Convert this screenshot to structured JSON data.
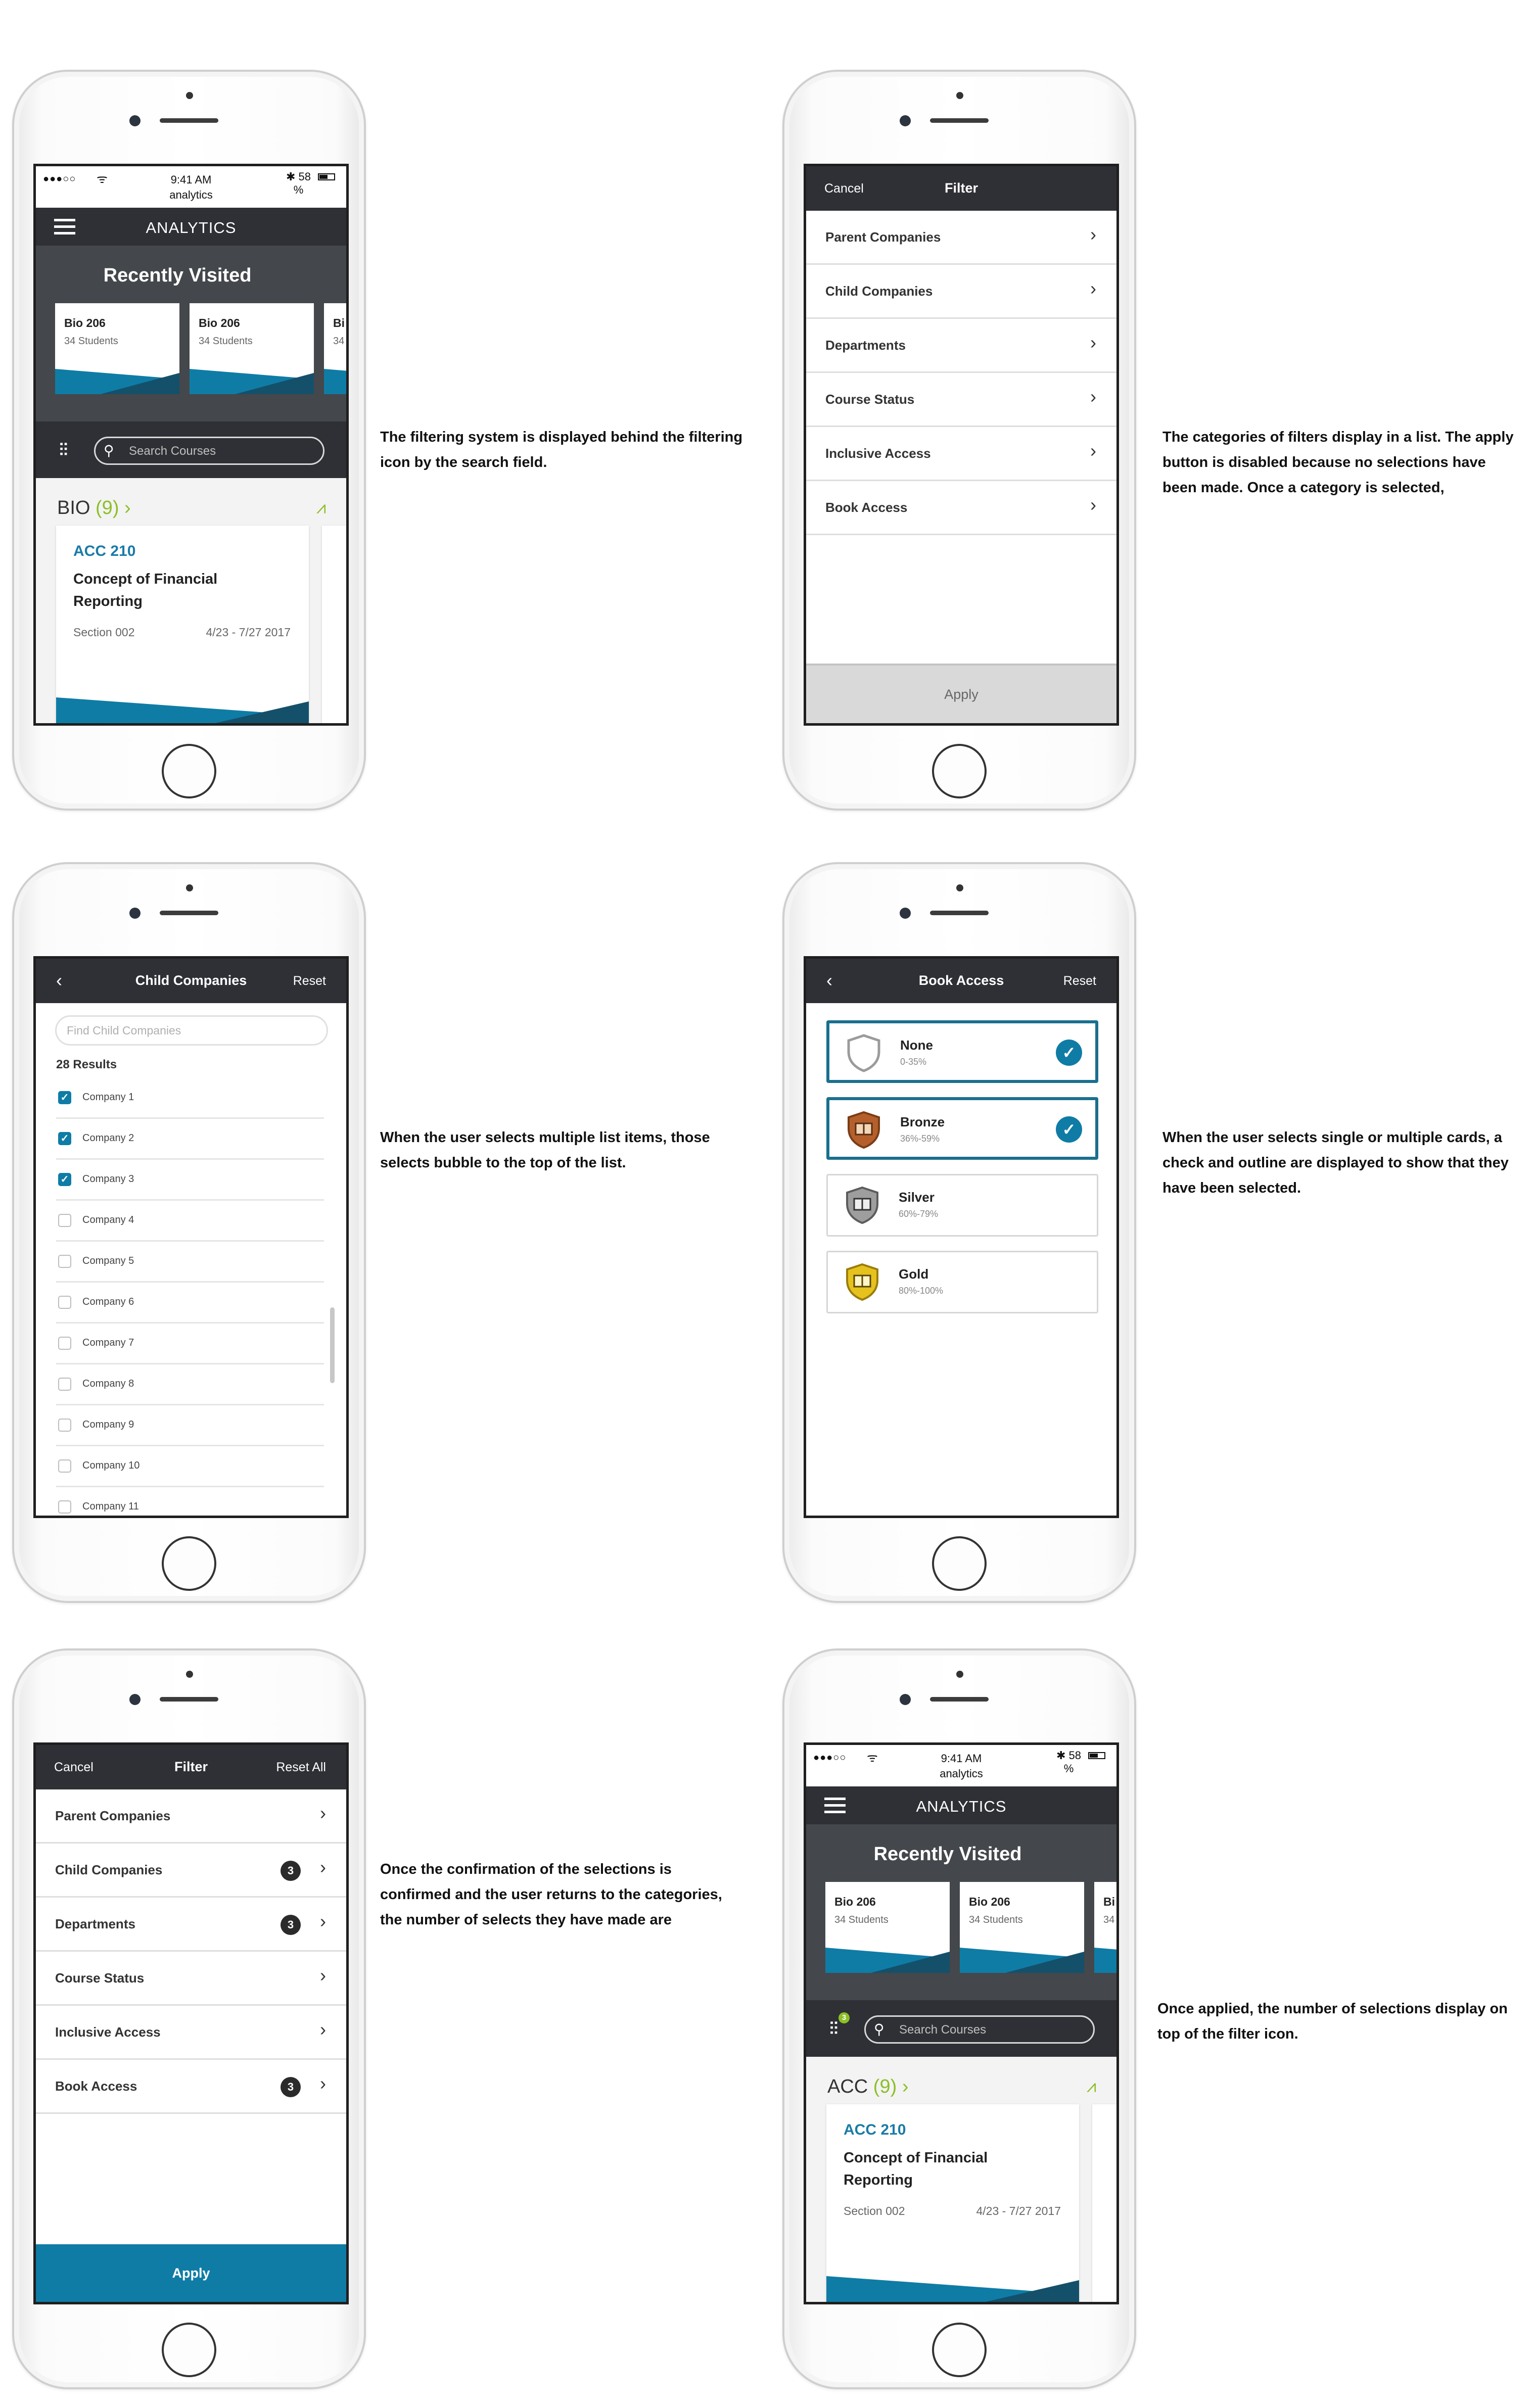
{
  "colors": {
    "accent_blue": "#0f7ca6",
    "accent_green": "#8cbf26",
    "dark_bar": "#2e3035",
    "recently_visited_bg": "#44474b"
  },
  "status": {
    "dots": "●●●○○",
    "wifi": "ᯤ",
    "time": "9:41 AM",
    "carrier": "analytics",
    "bt": "✱ 58",
    "pct": "%"
  },
  "analytics": {
    "title": "ANALYTICS",
    "recently_visited": "Recently Visited",
    "cards": [
      {
        "name": "Bio 206",
        "sub": "34 Students"
      },
      {
        "name": "Bio 206",
        "sub": "34 Students"
      },
      {
        "name": "Bi",
        "sub": "34"
      }
    ],
    "search_placeholder": "Search Courses",
    "course": {
      "code": "ACC 210",
      "name": "Concept of Financial Reporting",
      "section": "Section 002",
      "dates": "4/23 - 7/27  2017"
    }
  },
  "screen1": {
    "group": "BIO",
    "count": "(9)",
    "arrow": "›"
  },
  "screen6": {
    "group": "ACC",
    "count": "(9)",
    "arrow": "›",
    "filter_badge": "3"
  },
  "filter": {
    "cancel": "Cancel",
    "title": "Filter",
    "reset_all": "Reset All",
    "apply": "Apply",
    "items": [
      "Parent Companies",
      "Child Companies",
      "Departments",
      "Course Status",
      "Inclusive Access",
      "Book Access"
    ],
    "counts": [
      "",
      "3",
      "3",
      "",
      "",
      "3"
    ]
  },
  "child_companies": {
    "title": "Child Companies",
    "reset": "Reset",
    "placeholder": "Find Child Companies",
    "results": "28 Results",
    "items": [
      "Company 1",
      "Company 2",
      "Company 3",
      "Company 4",
      "Company 5",
      "Company 6",
      "Company 7",
      "Company 8",
      "Company 9",
      "Company 10",
      "Company 11"
    ],
    "checked": [
      true,
      true,
      true,
      false,
      false,
      false,
      false,
      false,
      false,
      false,
      false
    ]
  },
  "book_access": {
    "title": "Book Access",
    "reset": "Reset",
    "cards": [
      {
        "name": "None",
        "range": "0-35%",
        "selected": true,
        "color": "#ffffff",
        "stroke": "#9b9b9b"
      },
      {
        "name": "Bronze",
        "range": "36%-59%",
        "selected": true,
        "color": "#b5602c",
        "stroke": "#7a3d17"
      },
      {
        "name": "Silver",
        "range": "60%-79%",
        "selected": false,
        "color": "#9e9e9e",
        "stroke": "#5c5c5c"
      },
      {
        "name": "Gold",
        "range": "80%-100%",
        "selected": false,
        "color": "#e5c21e",
        "stroke": "#9b7d0b"
      }
    ]
  },
  "captions": {
    "c1": "The filtering system is displayed behind the filtering icon by the search field.",
    "c2": "The categories of filters display in a list. The apply button is disabled because no selections have been made. Once a category is selected,",
    "c3": "When the user selects multiple list items, those selects bubble to the top of the list.",
    "c4": "When the user selects single or multiple cards, a check and outline are displayed to show that they have been selected.",
    "c5": "Once the confirmation of the selections is confirmed and the user returns to the categories, the number of selects they have made are",
    "c6": "Once applied, the number of selections display on top of the filter icon."
  }
}
